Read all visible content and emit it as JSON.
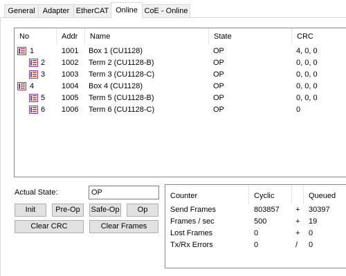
{
  "tabs": [
    {
      "label": "General",
      "active": false
    },
    {
      "label": "Adapter",
      "active": false
    },
    {
      "label": "EtherCAT",
      "active": false
    },
    {
      "label": "Online",
      "active": true
    },
    {
      "label": "CoE - Online",
      "active": false
    }
  ],
  "device_list": {
    "columns": [
      "No",
      "Addr",
      "Name",
      "State",
      "CRC"
    ],
    "rows": [
      {
        "no": "1",
        "addr": "1001",
        "name": "Box 1 (CU1128)",
        "state": "OP",
        "crc": "4, 0, 0",
        "icon": "ethercat-box-icon"
      },
      {
        "no": "2",
        "addr": "1002",
        "name": "Term 2 (CU1128-B)",
        "state": "OP",
        "crc": "0, 0, 0",
        "icon": "ethercat-terminal-icon"
      },
      {
        "no": "3",
        "addr": "1003",
        "name": "Term 3 (CU1128-C)",
        "state": "OP",
        "crc": "0, 0, 0",
        "icon": "ethercat-terminal-icon"
      },
      {
        "no": "4",
        "addr": "1004",
        "name": "Box 4 (CU1128)",
        "state": "OP",
        "crc": "0, 0, 0",
        "icon": "ethercat-box-icon"
      },
      {
        "no": "5",
        "addr": "1005",
        "name": "Term 5 (CU1128-B)",
        "state": "OP",
        "crc": "0, 0, 0",
        "icon": "ethercat-terminal-icon"
      },
      {
        "no": "6",
        "addr": "1006",
        "name": "Term 6 (CU1128-C)",
        "state": "OP",
        "crc": "0",
        "icon": "ethercat-terminal-icon"
      }
    ]
  },
  "actual_state": {
    "label": "Actual State:",
    "value": "OP"
  },
  "buttons": {
    "init": "Init",
    "preop": "Pre-Op",
    "safeop": "Safe-Op",
    "op": "Op",
    "clear_crc": "Clear CRC",
    "clear_frames": "Clear Frames"
  },
  "frame_stats": {
    "headers": {
      "counter": "Counter",
      "cyclic": "Cyclic",
      "queued": "Queued"
    },
    "rows": [
      {
        "counter": "Send Frames",
        "cyclic": "803857",
        "op": "+",
        "queued": "30397"
      },
      {
        "counter": "Frames / sec",
        "cyclic": "500",
        "op": "+",
        "queued": "19"
      },
      {
        "counter": "Lost Frames",
        "cyclic": "0",
        "op": "+",
        "queued": "0"
      },
      {
        "counter": "Tx/Rx Errors",
        "cyclic": "0",
        "op": "/",
        "queued": "0"
      }
    ]
  },
  "colors": {
    "icon_purple": "#7b3f98",
    "icon_red": "#c0392b",
    "border": "#828790",
    "button_face": "#e1e1e1"
  }
}
